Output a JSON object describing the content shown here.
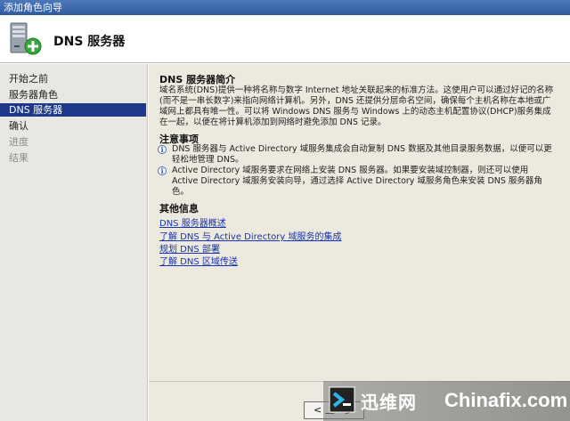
{
  "window": {
    "title": "添加角色向导"
  },
  "header": {
    "title": "DNS 服务器",
    "icon": "server-add-icon"
  },
  "sidebar": {
    "items": [
      {
        "label": "开始之前",
        "state": "normal"
      },
      {
        "label": "服务器角色",
        "state": "normal"
      },
      {
        "label": "DNS 服务器",
        "state": "selected"
      },
      {
        "label": "确认",
        "state": "normal"
      },
      {
        "label": "进度",
        "state": "disabled"
      },
      {
        "label": "结果",
        "state": "disabled"
      }
    ]
  },
  "main": {
    "intro_title": "DNS 服务器简介",
    "intro_text": "域名系统(DNS)提供一种将名称与数字 Internet 地址关联起来的标准方法。这使用户可以通过好记的名称(而不是一串长数字)来指向网络计算机。另外，DNS 还提供分层命名空间，确保每个主机名称在本地或广域网上都具有唯一性。可以将 Windows DNS 服务与 Windows 上的动态主机配置协议(DHCP)服务集成在一起，以便在将计算机添加到网络时避免添加 DNS 记录。",
    "notes_title": "注意事项",
    "notes": [
      "DNS 服务器与 Active Directory 域服务集成会自动复制 DNS 数据及其他目录服务数据，以便可以更轻松地管理 DNS。",
      "Active Directory 域服务要求在网络上安装 DNS 服务器。如果要安装域控制器，则还可以使用 Active Directory 域服务安装向导，通过选择 Active Directory 域服务角色来安装 DNS 服务器角色。"
    ],
    "more_title": "其他信息",
    "links": [
      "DNS 服务器概述",
      "了解 DNS 与 Active Directory 域服务的集成",
      "规划 DNS 部署",
      "了解 DNS 区域传送"
    ]
  },
  "footer": {
    "prev_label": "< 上一步"
  },
  "watermark": {
    "cn": "迅维网",
    "en": "Chinafix.com"
  },
  "colors": {
    "selected_bg": "#1d3a8a",
    "link": "#1a33b0",
    "titlebar": "#2f5aa0"
  }
}
